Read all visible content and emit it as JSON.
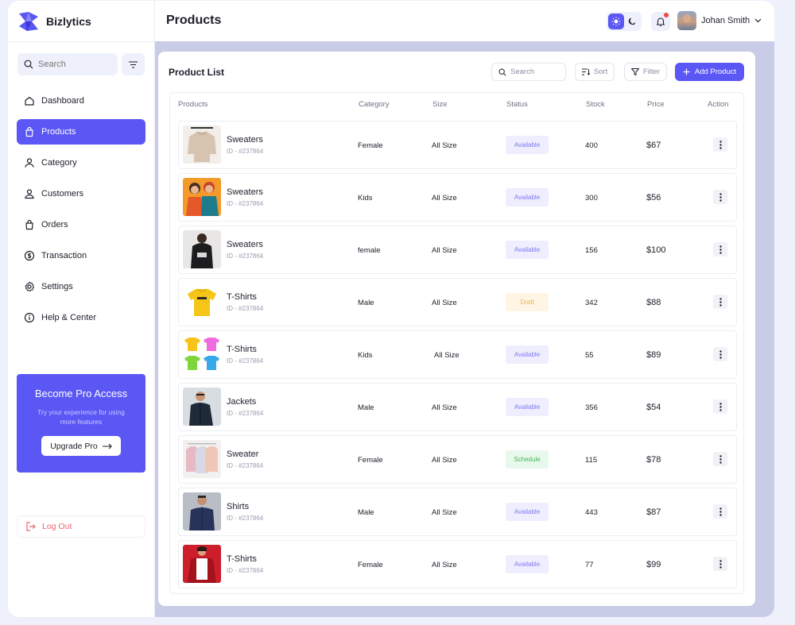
{
  "brand": {
    "name": "Bizlytics",
    "accent": "#5b57f5"
  },
  "sidebar": {
    "search_placeholder": "Search",
    "items": [
      {
        "label": "Dashboard",
        "icon": "home-icon",
        "active": false
      },
      {
        "label": "Products",
        "icon": "bag-icon",
        "active": true
      },
      {
        "label": "Category",
        "icon": "user-icon",
        "active": false
      },
      {
        "label": "Customers",
        "icon": "users-icon",
        "active": false
      },
      {
        "label": "Orders",
        "icon": "bag-icon",
        "active": false
      },
      {
        "label": "Transaction",
        "icon": "dollar-icon",
        "active": false
      },
      {
        "label": "Settings",
        "icon": "gear-icon",
        "active": false
      },
      {
        "label": "Help & Center",
        "icon": "info-icon",
        "active": false
      }
    ],
    "promo": {
      "title": "Become Pro Access",
      "subtitle": "Try your experience for using more features",
      "button": "Upgrade Pro"
    },
    "logout": "Log Out"
  },
  "header": {
    "title": "Products",
    "user_name": "Johan Smith"
  },
  "product_list": {
    "title": "Product List",
    "search_placeholder": "Search",
    "sort_label": "Sort",
    "filter_label": "Filter",
    "add_label": "Add Product",
    "columns": [
      "Products",
      "Category",
      "Size",
      "Status",
      "Stock",
      "Price",
      "Action"
    ],
    "rows": [
      {
        "name": "Sweaters",
        "id": "ID - #237864",
        "category": "Female",
        "size": "All Size",
        "status": "Available",
        "stock": "400",
        "price": "$67",
        "thumb": "sweater-beige"
      },
      {
        "name": "Sweaters",
        "id": "ID - #237864",
        "category": "Kids",
        "size": "All Size",
        "status": "Available",
        "stock": "300",
        "price": "$56",
        "thumb": "kids-photo"
      },
      {
        "name": "Sweaters",
        "id": "ID - #237864",
        "category": "female",
        "size": "All Size",
        "status": "Available",
        "stock": "156",
        "price": "$100",
        "thumb": "hoodie-black"
      },
      {
        "name": "T-Shirts",
        "id": "ID - #237864",
        "category": "Male",
        "size": "All Size",
        "status": "Draft",
        "stock": "342",
        "price": "$88",
        "thumb": "tshirt-yellow"
      },
      {
        "name": "T-Shirts",
        "id": "ID - #237864",
        "category": "Kids",
        "size": "All Size",
        "status": "Available",
        "stock": "55",
        "price": "$89",
        "thumb": "tshirts-multi"
      },
      {
        "name": "Jackets",
        "id": "ID - #237864",
        "category": "Male",
        "size": "All Size",
        "status": "Available",
        "stock": "356",
        "price": "$54",
        "thumb": "jacket-man"
      },
      {
        "name": "Sweater",
        "id": "ID - #237864",
        "category": "Female",
        "size": "All Size",
        "status": "Schedule",
        "stock": "115",
        "price": "$78",
        "thumb": "sweaters-pastel"
      },
      {
        "name": "Shirts",
        "id": "ID - #237864",
        "category": "Male",
        "size": "All Size",
        "status": "Available",
        "stock": "443",
        "price": "$87",
        "thumb": "shirt-navy"
      },
      {
        "name": "T-Shirts",
        "id": "ID - #237864",
        "category": "Female",
        "size": "All Size",
        "status": "Available",
        "stock": "77",
        "price": "$99",
        "thumb": "tshirt-white-red"
      }
    ]
  }
}
